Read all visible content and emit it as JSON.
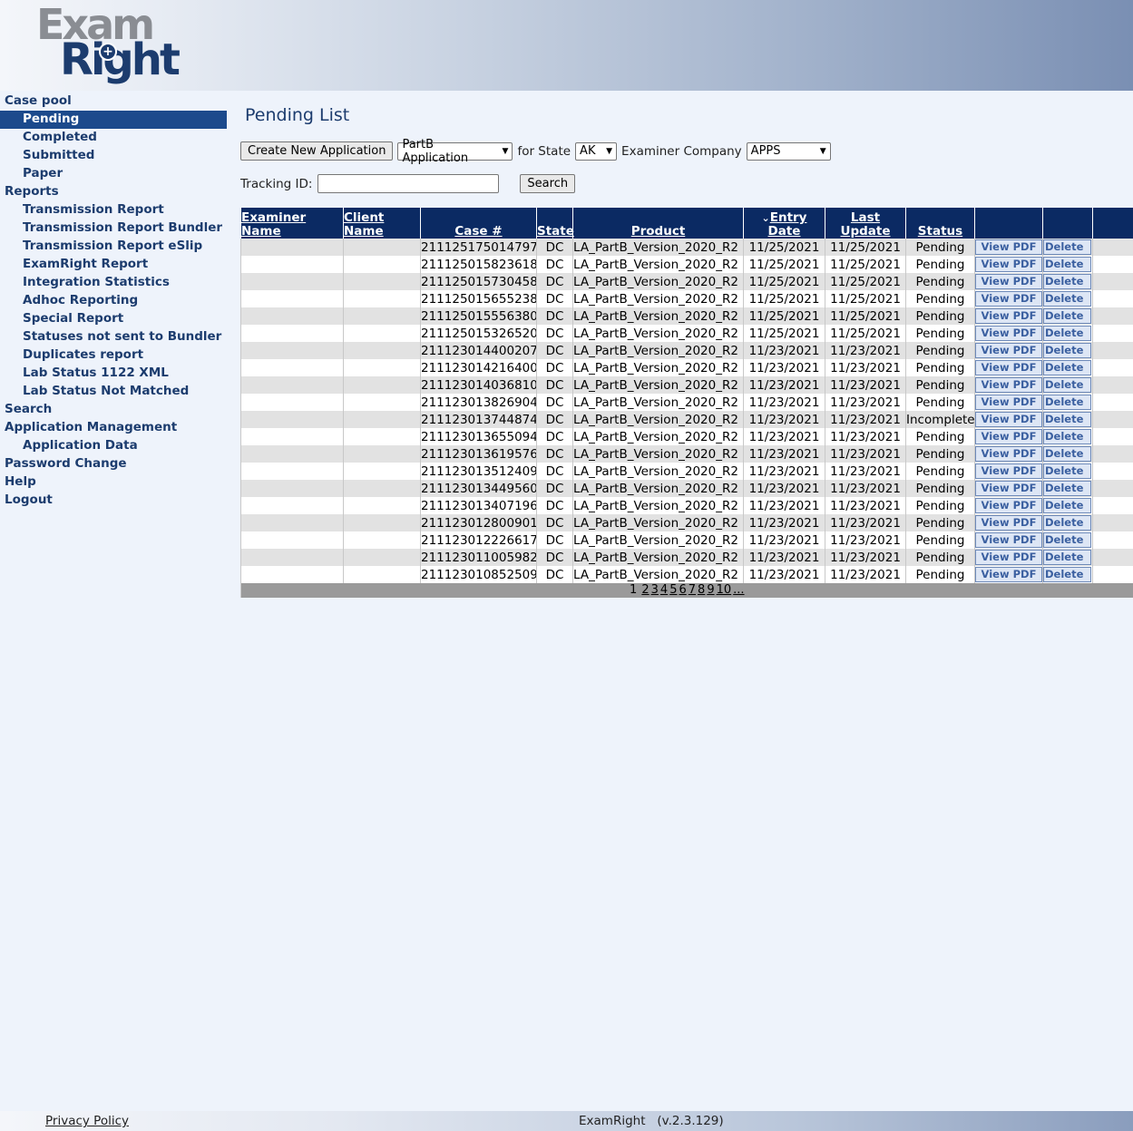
{
  "logo": {
    "line1": "Exam",
    "line2": "Right"
  },
  "nav": [
    {
      "label": "Case pool",
      "level": "top",
      "active": false
    },
    {
      "label": "Pending",
      "level": "sub",
      "active": true
    },
    {
      "label": "Completed",
      "level": "sub",
      "active": false
    },
    {
      "label": "Submitted",
      "level": "sub",
      "active": false
    },
    {
      "label": "Paper",
      "level": "sub",
      "active": false
    },
    {
      "label": "Reports",
      "level": "top",
      "active": false
    },
    {
      "label": "Transmission Report",
      "level": "sub",
      "active": false
    },
    {
      "label": "Transmission Report Bundler",
      "level": "sub",
      "active": false
    },
    {
      "label": "Transmission Report eSlip",
      "level": "sub",
      "active": false
    },
    {
      "label": "ExamRight Report",
      "level": "sub",
      "active": false
    },
    {
      "label": "Integration Statistics",
      "level": "sub",
      "active": false
    },
    {
      "label": "Adhoc Reporting",
      "level": "sub",
      "active": false
    },
    {
      "label": "Special Report",
      "level": "sub",
      "active": false
    },
    {
      "label": "Statuses not sent to Bundler",
      "level": "sub",
      "active": false
    },
    {
      "label": "Duplicates report",
      "level": "sub",
      "active": false
    },
    {
      "label": "Lab Status 1122 XML",
      "level": "sub",
      "active": false
    },
    {
      "label": "Lab Status Not Matched",
      "level": "sub",
      "active": false
    },
    {
      "label": "Search",
      "level": "top",
      "active": false
    },
    {
      "label": "Application Management",
      "level": "top",
      "active": false
    },
    {
      "label": "Application Data",
      "level": "sub",
      "active": false
    },
    {
      "label": "Password Change",
      "level": "top",
      "active": false
    },
    {
      "label": "Help",
      "level": "top",
      "active": false
    },
    {
      "label": "Logout",
      "level": "top",
      "active": false
    }
  ],
  "page": {
    "title": "Pending List"
  },
  "toolbar": {
    "create_label": "Create New Application",
    "app_type": "PartB Application",
    "for_state_label": "for State",
    "state": "AK",
    "examiner_company_label": "Examiner Company",
    "company": "APPS"
  },
  "tracking": {
    "label": "Tracking ID:",
    "value": "",
    "search_label": "Search"
  },
  "table": {
    "headers": {
      "examiner_name": [
        "Examiner",
        "Name"
      ],
      "client_name": [
        "Client",
        "Name"
      ],
      "case": "Case #",
      "state": "State",
      "product": "Product",
      "entry_date": [
        "Entry",
        "Date"
      ],
      "last_update": [
        "Last",
        "Update"
      ],
      "status": "Status"
    },
    "sort_indicator": "⌄",
    "view_pdf_label": "View PDF",
    "delete_label": "Delete",
    "rows": [
      {
        "examiner": "",
        "client": "",
        "case": "211125175014797",
        "state": "DC",
        "product": "LA_PartB_Version_2020_R2",
        "entry": "11/25/2021",
        "update": "11/25/2021",
        "status": "Pending"
      },
      {
        "examiner": "",
        "client": "",
        "case": "211125015823618",
        "state": "DC",
        "product": "LA_PartB_Version_2020_R2",
        "entry": "11/25/2021",
        "update": "11/25/2021",
        "status": "Pending"
      },
      {
        "examiner": "",
        "client": "",
        "case": "211125015730458",
        "state": "DC",
        "product": "LA_PartB_Version_2020_R2",
        "entry": "11/25/2021",
        "update": "11/25/2021",
        "status": "Pending"
      },
      {
        "examiner": "",
        "client": "",
        "case": "211125015655238",
        "state": "DC",
        "product": "LA_PartB_Version_2020_R2",
        "entry": "11/25/2021",
        "update": "11/25/2021",
        "status": "Pending"
      },
      {
        "examiner": "",
        "client": "",
        "case": "211125015556380",
        "state": "DC",
        "product": "LA_PartB_Version_2020_R2",
        "entry": "11/25/2021",
        "update": "11/25/2021",
        "status": "Pending"
      },
      {
        "examiner": "",
        "client": "",
        "case": "211125015326520",
        "state": "DC",
        "product": "LA_PartB_Version_2020_R2",
        "entry": "11/25/2021",
        "update": "11/25/2021",
        "status": "Pending"
      },
      {
        "examiner": "",
        "client": "",
        "case": "211123014400207",
        "state": "DC",
        "product": "LA_PartB_Version_2020_R2",
        "entry": "11/23/2021",
        "update": "11/23/2021",
        "status": "Pending"
      },
      {
        "examiner": "",
        "client": "",
        "case": "211123014216400",
        "state": "DC",
        "product": "LA_PartB_Version_2020_R2",
        "entry": "11/23/2021",
        "update": "11/23/2021",
        "status": "Pending"
      },
      {
        "examiner": "",
        "client": "",
        "case": "211123014036810",
        "state": "DC",
        "product": "LA_PartB_Version_2020_R2",
        "entry": "11/23/2021",
        "update": "11/23/2021",
        "status": "Pending"
      },
      {
        "examiner": "",
        "client": "",
        "case": "211123013826904",
        "state": "DC",
        "product": "LA_PartB_Version_2020_R2",
        "entry": "11/23/2021",
        "update": "11/23/2021",
        "status": "Pending"
      },
      {
        "examiner": "",
        "client": "",
        "case": "211123013744874",
        "state": "DC",
        "product": "LA_PartB_Version_2020_R2",
        "entry": "11/23/2021",
        "update": "11/23/2021",
        "status": "Incomplete"
      },
      {
        "examiner": "",
        "client": "",
        "case": "211123013655094",
        "state": "DC",
        "product": "LA_PartB_Version_2020_R2",
        "entry": "11/23/2021",
        "update": "11/23/2021",
        "status": "Pending"
      },
      {
        "examiner": "",
        "client": "",
        "case": "211123013619576",
        "state": "DC",
        "product": "LA_PartB_Version_2020_R2",
        "entry": "11/23/2021",
        "update": "11/23/2021",
        "status": "Pending"
      },
      {
        "examiner": "",
        "client": "",
        "case": "211123013512409",
        "state": "DC",
        "product": "LA_PartB_Version_2020_R2",
        "entry": "11/23/2021",
        "update": "11/23/2021",
        "status": "Pending"
      },
      {
        "examiner": "",
        "client": "",
        "case": "211123013449560",
        "state": "DC",
        "product": "LA_PartB_Version_2020_R2",
        "entry": "11/23/2021",
        "update": "11/23/2021",
        "status": "Pending"
      },
      {
        "examiner": "",
        "client": "",
        "case": "211123013407196",
        "state": "DC",
        "product": "LA_PartB_Version_2020_R2",
        "entry": "11/23/2021",
        "update": "11/23/2021",
        "status": "Pending"
      },
      {
        "examiner": "",
        "client": "",
        "case": "211123012800901",
        "state": "DC",
        "product": "LA_PartB_Version_2020_R2",
        "entry": "11/23/2021",
        "update": "11/23/2021",
        "status": "Pending"
      },
      {
        "examiner": "",
        "client": "",
        "case": "211123012226617",
        "state": "DC",
        "product": "LA_PartB_Version_2020_R2",
        "entry": "11/23/2021",
        "update": "11/23/2021",
        "status": "Pending"
      },
      {
        "examiner": "",
        "client": "",
        "case": "211123011005982",
        "state": "DC",
        "product": "LA_PartB_Version_2020_R2",
        "entry": "11/23/2021",
        "update": "11/23/2021",
        "status": "Pending"
      },
      {
        "examiner": "",
        "client": "",
        "case": "211123010852509",
        "state": "DC",
        "product": "LA_PartB_Version_2020_R2",
        "entry": "11/23/2021",
        "update": "11/23/2021",
        "status": "Pending"
      }
    ]
  },
  "pager": {
    "current": "1",
    "pages": [
      "2",
      "3",
      "4",
      "5",
      "6",
      "7",
      "8",
      "9",
      "10",
      "..."
    ]
  },
  "footer": {
    "privacy_label": "Privacy Policy",
    "brand": "ExamRight   (v.2.3.129)"
  },
  "colors": {
    "header_navy": "#0b2a63",
    "nav_text": "#1c3c6e",
    "active_nav": "#1c4a8c",
    "page_bg": "#eef3fb",
    "row_alt": "#e2e2e2"
  }
}
